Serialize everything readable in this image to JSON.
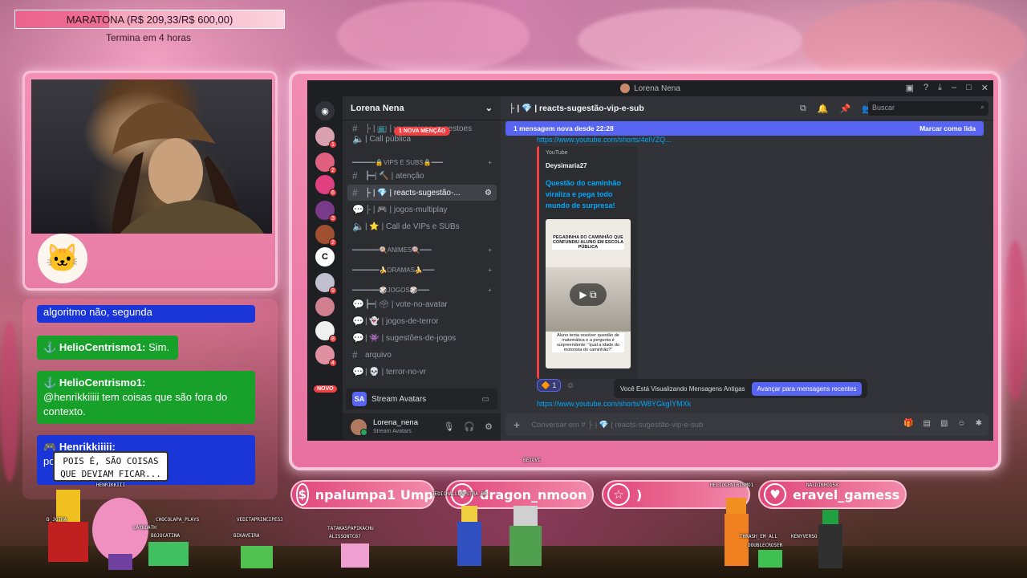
{
  "goal": {
    "label": "MARATONA (R$ 209,33/R$ 600,00)",
    "progress": 0.349,
    "subtitle": "Termina em 4 horas"
  },
  "chat": {
    "top_partial": "algoritmo não, segunda",
    "messages": [
      {
        "user": "HelioCentrismo1:",
        "text": "Sim.",
        "color": "green"
      },
      {
        "user": "HelioCentrismo1:",
        "text": "@henrikkiiiii tem coisas que são fora do contexto.",
        "color": "green"
      },
      {
        "user": "Henrikkiiiii:",
        "text": "po... fa...",
        "color": "blue"
      }
    ],
    "speech_bubble": "POIS É, SÃO COISAS QUE DEVIAM FICAR..."
  },
  "discord": {
    "window_title": "Lorena Nena",
    "server_name": "Lorena Nena",
    "new_mention_badge": "1 NOVA MENÇÃO",
    "novo_badge": "NOVO",
    "channels": [
      {
        "icon": "#",
        "label": "├ | 📺 | vr-musicas-sugestoes"
      },
      {
        "icon": "🔊",
        "label": "| Call pública"
      },
      {
        "icon": "cat",
        "label": "━━━━━━🔒VIPS E SUBS🔒━━━"
      },
      {
        "icon": "#",
        "label": "┣━| 🔨 | atenção"
      },
      {
        "icon": "#",
        "label": "├ | 💎 | reacts-sugestão-..."
      },
      {
        "icon": "💬",
        "label": "├ | 🎮 | jogos-multiplay"
      },
      {
        "icon": "🔊",
        "label": "| ⭐ | Call de VIPs e SUBs"
      },
      {
        "icon": "cat",
        "label": "━━━━━━━🍭ANIMES🍭━━━"
      },
      {
        "icon": "cat",
        "label": "━━━━━━━🍌DRAMAS🍌━━━"
      },
      {
        "icon": "cat",
        "label": "━━━━━━━🎲JOGOS🎲━━━"
      },
      {
        "icon": "💬",
        "label": "┣━| 🗳 | vote-no-avatar"
      },
      {
        "icon": "💬",
        "label": "| 👻 | jogos-de-terror"
      },
      {
        "icon": "💬",
        "label": "| 👾 | sugestões-de-jogos"
      },
      {
        "icon": "#",
        "label": "arquivo"
      },
      {
        "icon": "💬",
        "label": "| 💀 | terror-no-vr"
      }
    ],
    "stream_avatars": "Stream Avatars",
    "user": {
      "name": "Lorena_nena",
      "status": "Stream Avatars"
    },
    "channel_header": "├ | 💎 | reacts-sugestão-vip-e-sub",
    "search_placeholder": "Buscar",
    "new_messages_bar": "1 mensagem nova desde 22:28",
    "mark_read": "Marcar como lida",
    "link_top": "https://www.youtube.com/shorts/4elVZQ...",
    "embed": {
      "provider": "YouTube",
      "author": "Deysimaria27",
      "title": "Questão do caminhão viraliza e pega todo mundo de surpresa!",
      "thumb_top": "PEGADINHA DO CAMINHÃO QUE CONFUNDIU ALUNO EM ESCOLA PÚBLICA",
      "thumb_bottom": "Aluno tenta resolver questão de matemática e a pergunta é surpreendente: \"qual a idade do motorista do caminhão?\""
    },
    "reaction": {
      "emoji": "🔶",
      "count": "1"
    },
    "old_messages_notice": "Você Está Visualizando Mensagens Antigas",
    "jump_button": "Avançar para mensagens recentes",
    "link_bottom": "https://www.youtube.com/shorts/W8YGkgIYMXk",
    "composer_placeholder": "Conversar em # ├ | 💎 | reacts-sugestão-vip-e-sub"
  },
  "alerts": [
    {
      "icon": "$",
      "text": "npalumpa1   Ump"
    },
    {
      "icon": "♥",
      "text": "dragon_nmoon"
    },
    {
      "icon": "☆",
      "text": ")"
    },
    {
      "icon": "♥",
      "text": "eravel_gamess"
    }
  ],
  "avatar_names": [
    "D_JOTHA",
    "HENRIKKIII",
    "CHOCOLAPA_PLAYS",
    "LAYBOATH",
    "BOJOCATINA",
    "VEDITAPRINCIPESJ",
    "BIKAVEIRA",
    "TATAKASPAPIKACHU",
    "ALISSONTC87",
    "JEDICHALLENPUTRA_BR",
    "BETOVI",
    "HELIOCENTRISMO1",
    "NALDINHO158",
    "THRASH_EM_ALL",
    "KENYVERSO",
    "DOUBLECROSER"
  ],
  "colors": {
    "discord_blurple": "#5865f2",
    "chat_green": "#17a02a",
    "chat_blue": "#1a36d8",
    "alert_pink": "#e0467a"
  }
}
